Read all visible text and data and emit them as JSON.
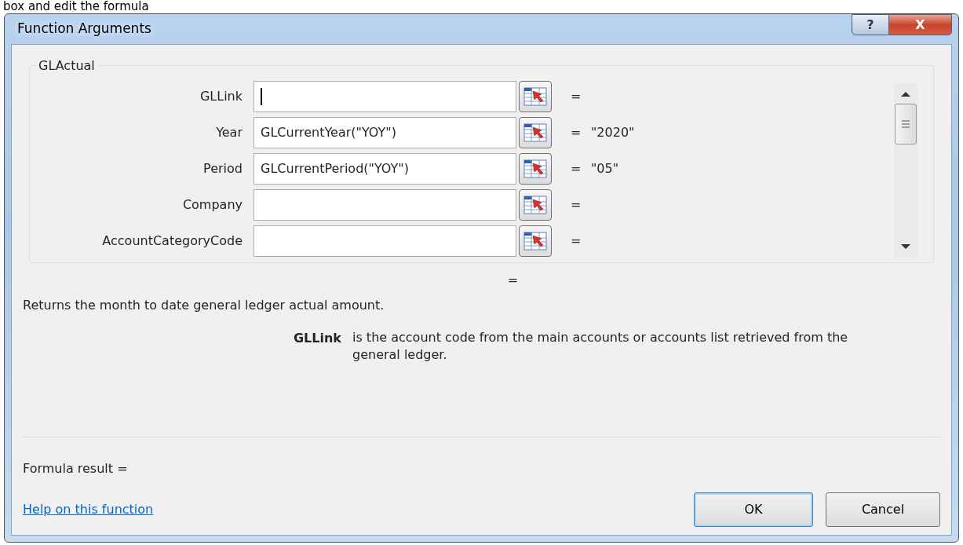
{
  "page_caption": "box and edit the formula",
  "window": {
    "title": "Function Arguments",
    "controls": [
      {
        "kind": "help",
        "label": "?"
      },
      {
        "kind": "close",
        "label": "X"
      }
    ]
  },
  "group": {
    "title": "GLActual",
    "arguments": [
      {
        "label": "GLLink",
        "focused": true,
        "equals": "="
      },
      {
        "label": "Year",
        "value": "GLCurrentYear(\"YOY\")",
        "focused": false,
        "equals": "=",
        "result": "\"2020\""
      },
      {
        "label": "Period",
        "value": "GLCurrentPeriod(\"YOY\")",
        "focused": false,
        "equals": "=",
        "result": "\"05\""
      },
      {
        "label": "Company",
        "focused": false,
        "equals": "="
      },
      {
        "label": "AccountCategoryCode",
        "focused": false,
        "equals": "="
      }
    ]
  },
  "function_result": "=",
  "description": "Returns the month to date general ledger actual amount.",
  "argument_help": {
    "name": "GLLink",
    "text": "is the account code from the main accounts or accounts list retrieved from the general ledger."
  },
  "formula_result": "Formula result =",
  "help_link": "Help on this function",
  "buttons": [
    {
      "label": "OK",
      "default": true
    },
    {
      "label": "Cancel",
      "default": false
    }
  ]
}
